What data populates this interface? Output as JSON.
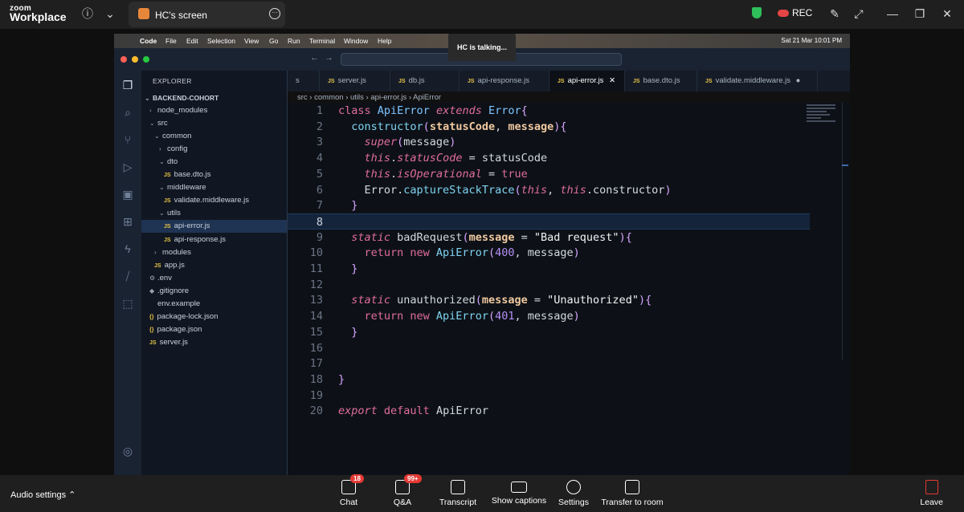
{
  "zoom": {
    "logo_top": "zoom",
    "logo_bottom": "Workplace",
    "screen_tab_label": "HC's screen",
    "rec_label": "REC",
    "talking": "HC is talking..."
  },
  "mac_menubar": {
    "app": "Code",
    "items": [
      "File",
      "Edit",
      "Selection",
      "View",
      "Go",
      "Run",
      "Terminal",
      "Window",
      "Help"
    ],
    "datetime": "Sat 21 Mar  10:01 PM"
  },
  "explorer": {
    "header": "EXPLORER",
    "root": "BACKEND-COHORT",
    "items": [
      {
        "label": "node_modules",
        "kind": "folder-closed"
      },
      {
        "label": "src",
        "kind": "folder-open"
      },
      {
        "label": "common",
        "kind": "folder-open"
      },
      {
        "label": "config",
        "kind": "folder-closed"
      },
      {
        "label": "dto",
        "kind": "folder-open"
      },
      {
        "label": "base.dto.js",
        "kind": "js"
      },
      {
        "label": "middleware",
        "kind": "folder-open"
      },
      {
        "label": "validate.middleware.js",
        "kind": "js"
      },
      {
        "label": "utils",
        "kind": "folder-open"
      },
      {
        "label": "api-error.js",
        "kind": "js",
        "selected": true
      },
      {
        "label": "api-response.js",
        "kind": "js"
      },
      {
        "label": "modules",
        "kind": "folder-closed"
      },
      {
        "label": "app.js",
        "kind": "js"
      },
      {
        "label": ".env",
        "kind": "gear"
      },
      {
        "label": ".gitignore",
        "kind": "diamond"
      },
      {
        "label": "env.example",
        "kind": "plain"
      },
      {
        "label": "package-lock.json",
        "kind": "json"
      },
      {
        "label": "package.json",
        "kind": "json"
      },
      {
        "label": "server.js",
        "kind": "js"
      }
    ]
  },
  "tabs": [
    {
      "label": "s",
      "active": false
    },
    {
      "label": "server.js",
      "active": false
    },
    {
      "label": "db.js",
      "active": false
    },
    {
      "label": "api-response.js",
      "active": false
    },
    {
      "label": "api-error.js",
      "active": true
    },
    {
      "label": "base.dto.js",
      "active": false
    },
    {
      "label": "validate.middleware.js",
      "active": false
    }
  ],
  "breadcrumb": [
    "src",
    "common",
    "utils",
    "api-error.js",
    "ApiError"
  ],
  "code": {
    "current_line": 8,
    "line_numbers": [
      "1",
      "2",
      "3",
      "4",
      "5",
      "6",
      "7",
      "8",
      "9",
      "10",
      "11",
      "12",
      "13",
      "14",
      "15",
      "16",
      "17",
      "18",
      "19",
      "20"
    ]
  },
  "bottom_bar": {
    "audio_settings": "Audio settings",
    "buttons": [
      {
        "label": "Chat",
        "badge": "18"
      },
      {
        "label": "Q&A",
        "badge": "99+"
      },
      {
        "label": "Transcript"
      },
      {
        "label": "Show captions"
      },
      {
        "label": "Settings"
      },
      {
        "label": "Transfer to room"
      }
    ],
    "leave": "Leave"
  }
}
